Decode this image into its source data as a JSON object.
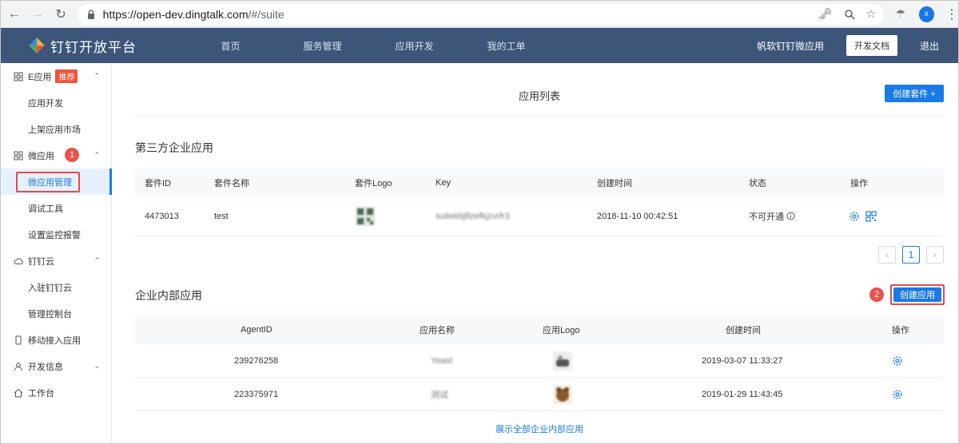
{
  "browser": {
    "url_host": "https://open-dev.dingtalk.com",
    "url_path": "/#/suite",
    "profile_initial": "x"
  },
  "topnav": {
    "brand": "钉钉开放平台",
    "menu": [
      "首页",
      "服务管理",
      "应用开发",
      "我的工单"
    ],
    "org_name": "帆软钉钉微应用",
    "doc_button": "开发文档",
    "logout": "退出"
  },
  "sidebar": {
    "groups": [
      {
        "label": "E应用",
        "badge": "推荐",
        "items": [
          "应用开发",
          "上架应用市场"
        ]
      },
      {
        "label": "微应用",
        "items": [
          "微应用管理",
          "调试工具",
          "设置监控报警"
        ]
      },
      {
        "label": "钉钉云",
        "items": [
          "入驻钉钉云",
          "管理控制台"
        ]
      },
      {
        "label": "移动接入应用"
      },
      {
        "label": "开发信息"
      },
      {
        "label": "工作台"
      }
    ]
  },
  "annotations": {
    "step1": "1",
    "step2": "2"
  },
  "main": {
    "page_title": "应用列表",
    "create_suite": "创建套件 +",
    "third_party": {
      "title": "第三方企业应用",
      "columns": [
        "套件ID",
        "套件名称",
        "套件Logo",
        "Key",
        "创建时间",
        "状态",
        "操作"
      ],
      "rows": [
        {
          "id": "4473013",
          "name": "test",
          "key": "suitekbjflzefkjzvrfr3",
          "created": "2018-11-10 00:42:51",
          "status": "不可开通"
        }
      ],
      "page": "1"
    },
    "internal": {
      "title": "企业内部应用",
      "create_button": "创建应用",
      "columns": [
        "AgentID",
        "应用名称",
        "应用Logo",
        "创建时间",
        "操作"
      ],
      "rows": [
        {
          "agent_id": "239276258",
          "name": "Yeast",
          "created": "2019-03-07 11:33:27"
        },
        {
          "agent_id": "223375971",
          "name": "测试",
          "created": "2019-01-29 11:43:45"
        }
      ],
      "show_all": "展示全部企业内部应用"
    }
  },
  "colors": {
    "nav_bg": "#3c5578",
    "primary": "#1a7ae6",
    "annotation": "#e34b4b"
  }
}
